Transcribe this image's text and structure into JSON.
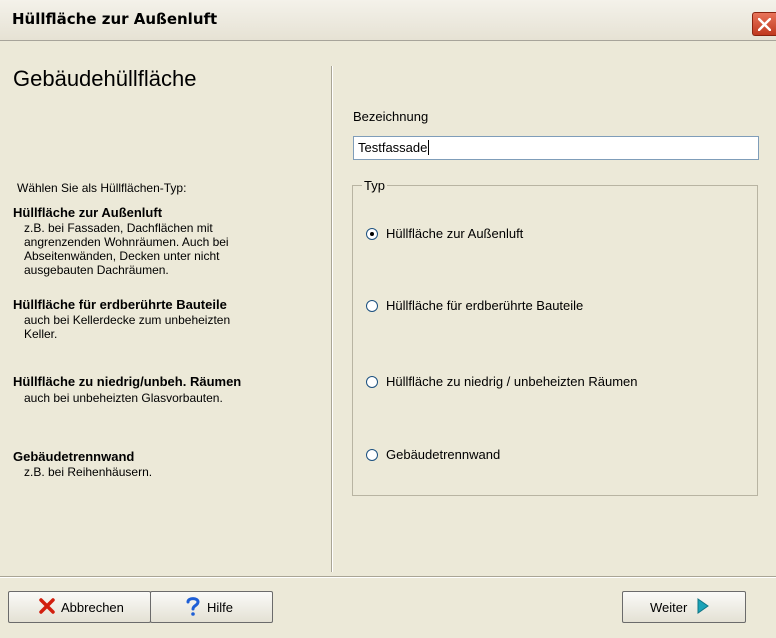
{
  "window": {
    "title": "Hüllfläche zur Außenluft"
  },
  "left": {
    "heading": "Gebäudehüllfläche",
    "intro": "Wählen Sie als Hüllflächen-Typ:",
    "options": [
      {
        "title": "Hüllfläche zur Außenluft",
        "desc_lines": [
          "z.B. bei Fassaden, Dachflächen mit",
          "angrenzenden Wohnräumen. Auch bei",
          "Abseitenwänden, Decken unter nicht",
          "ausgebauten Dachräumen."
        ]
      },
      {
        "title": "Hüllfläche für erdberührte Bauteile",
        "desc_lines": [
          "auch bei Kellerdecke zum unbeheizten",
          "Keller."
        ]
      },
      {
        "title": "Hüllfläche zu niedrig/unbeh. Räumen",
        "desc_lines": [
          "auch bei unbeheizten Glasvorbauten."
        ]
      },
      {
        "title": "Gebäudetrennwand",
        "desc_lines": [
          "z.B. bei Reihenhäusern."
        ]
      }
    ]
  },
  "form": {
    "name_label": "Bezeichnung",
    "name_value": "Testfassade",
    "type_label": "Typ",
    "radios": [
      {
        "label": "Hüllfläche zur Außenluft",
        "checked": true
      },
      {
        "label": "Hüllfläche für erdberührte Bauteile",
        "checked": false
      },
      {
        "label": "Hüllfläche zu niedrig / unbeheizten Räumen",
        "checked": false
      },
      {
        "label": "Gebäudetrennwand",
        "checked": false
      }
    ]
  },
  "buttons": {
    "cancel": "Abbrechen",
    "help": "Hilfe",
    "next": "Weiter"
  },
  "icons": {
    "close": "close-icon",
    "cancel": "red-x-icon",
    "help": "question-mark-icon",
    "next": "arrow-right-icon"
  },
  "colors": {
    "client_bg": "#ece9d8",
    "cancel_x": "#d21f0e",
    "help_q": "#1e5fd6",
    "next_arrow": "#1aa3b8"
  }
}
